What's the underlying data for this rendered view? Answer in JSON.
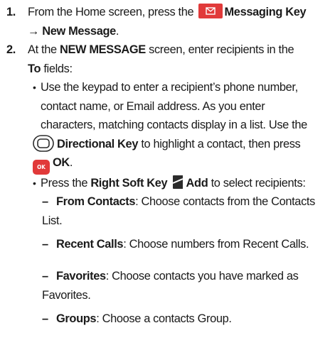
{
  "steps": [
    {
      "number": "1.",
      "line1_pre": "From the Home screen, press the",
      "line1_key": "Messaging Key",
      "line2": "→ New Message",
      "line2_end": "."
    },
    {
      "number": "2.",
      "line1_pre": "At the",
      "line1_bold": "NEW MESSAGE",
      "line1_post": "screen, enter recipients in the",
      "line2_bold": "To",
      "line2_post": "fields:"
    }
  ],
  "bullets": [
    {
      "lines": [
        "Use the keypad to enter a recipient’s phone number,",
        "contact name, or Email address. As you enter",
        "characters, matching contacts display in a list. Use the"
      ],
      "dir_key": "Directional Key",
      "dir_post": "to highlight a contact, then press",
      "ok_key": "OK",
      "ok_end": ".",
      "ok_icon_label": "OK"
    },
    {
      "pre": "Press the",
      "soft_key": "Right Soft Key",
      "action": "Add",
      "post": "to select recipients:"
    }
  ],
  "options": [
    {
      "label": "From Contacts",
      "desc": ": Choose contacts from the Contacts",
      "desc2": "List."
    },
    {
      "label": "Recent Calls",
      "desc": ": Choose numbers from Recent Calls."
    },
    {
      "label": "Favorites",
      "desc": ": Choose contacts you have marked as",
      "desc2": "Favorites."
    },
    {
      "label": "Groups",
      "desc": ": Choose a contacts Group."
    }
  ],
  "symbols": {
    "bullet": "•",
    "dash": "–"
  },
  "colors": {
    "key_red": "#e13a3a",
    "text": "#1a1a1a"
  },
  "icons": {
    "messaging_key": "envelope-icon",
    "directional_key": "directional-pad-icon",
    "ok_key": "ok-key-icon",
    "right_soft_key": "right-soft-key-icon"
  }
}
